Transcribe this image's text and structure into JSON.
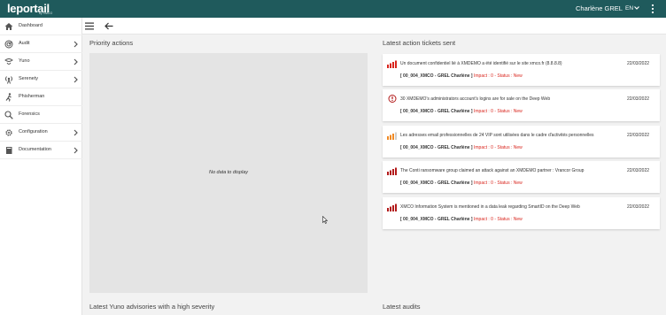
{
  "header": {
    "logo": "leportail",
    "logo_sub": "by XMCO",
    "user_name": "Charlène GREL",
    "language": "EN"
  },
  "sidebar": {
    "items": [
      {
        "label": "Dashboard",
        "icon": "home-icon"
      },
      {
        "label": "Audit",
        "icon": "radar-icon"
      },
      {
        "label": "Yuno",
        "icon": "yuno-icon"
      },
      {
        "label": "Serenety",
        "icon": "broadcast-icon"
      },
      {
        "label": "Phisherman",
        "icon": "hook-runner-icon"
      },
      {
        "label": "Forensics",
        "icon": "magnifier-icon"
      },
      {
        "label": "Configuration",
        "icon": "gear-icon"
      },
      {
        "label": "Documentation",
        "icon": "book-icon"
      }
    ]
  },
  "main": {
    "priority_title": "Priority actions",
    "priority_empty": "No data to display",
    "tickets_title": "Latest action tickets sent",
    "yuno_title": "Latest Yuno advisories with a high severity",
    "audits_title": "Latest audits"
  },
  "tickets": [
    {
      "title": "Un document confidentiel lié à XMDEMO a été identifié sur le site xmco.fr (8.8.8.8)",
      "date": "22/03/2022",
      "entity": "[ 00_004_XMCO - GREL Charlène ]",
      "status": "Impact : 0 - Status : New",
      "icon": "severity-bars-icon",
      "color": "#d9251d"
    },
    {
      "title": "30 XMDEMO's administrators account's logins are for sale on the Deep Web",
      "date": "22/03/2022",
      "entity": "[ 00_004_XMCO - GREL Charlène ]",
      "status": "Impact : 0 - Status : New",
      "icon": "critical-alert-icon",
      "color": "#b31b1b"
    },
    {
      "title": "Les adresses email professionnelles de 24 VIP sont utilisées dans le cadre d'activités personnelles",
      "date": "22/03/2022",
      "entity": "[ 00_004_XMCO - GREL Charlène ]",
      "status": "Impact : 0 - Status : New",
      "icon": "severity-bars-icon",
      "color": "#f08a24"
    },
    {
      "title": "The Conti ransomware group claimed an attack against an XMDEMO partner : Vrancor Group",
      "date": "22/03/2022",
      "entity": "[ 00_004_XMCO - GREL Charlène ]",
      "status": "Impact : 0 - Status : New",
      "icon": "severity-bars-icon",
      "color": "#b31b1b"
    },
    {
      "title": "XMCO Information System is mentioned in a data leak regarding SmartID on the Deep Web",
      "date": "22/03/2022",
      "entity": "[ 00_004_XMCO - GREL Charlène ]",
      "status": "Impact : 0 - Status : New",
      "icon": "severity-bars-icon",
      "color": "#b31b1b"
    }
  ]
}
